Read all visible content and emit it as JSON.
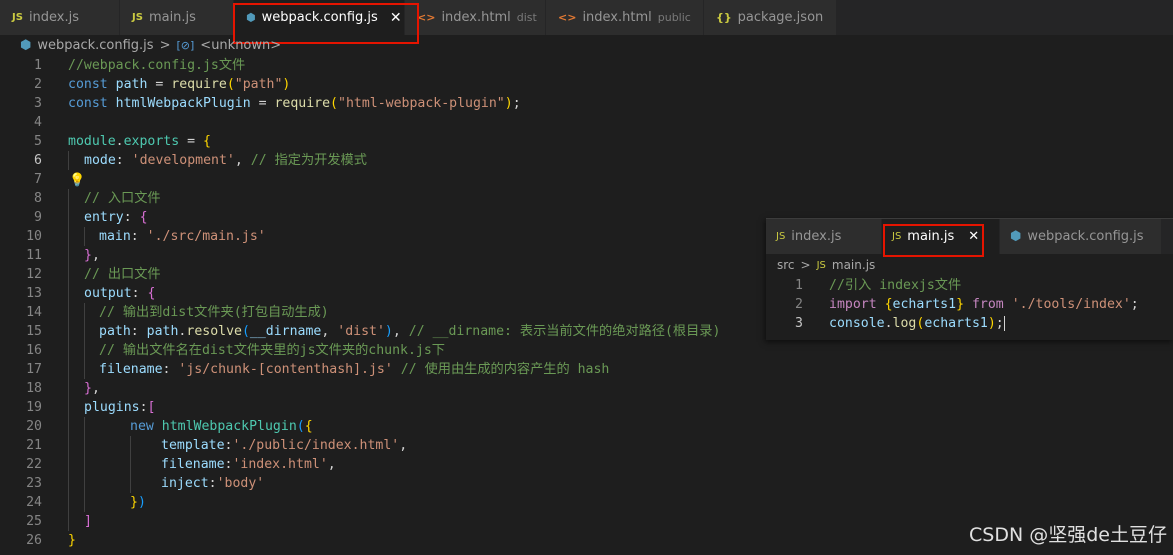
{
  "tabs": [
    {
      "icon": "JS",
      "label": "index.js",
      "sub": "",
      "active": false
    },
    {
      "icon": "JS",
      "label": "main.js",
      "sub": "",
      "active": false
    },
    {
      "icon": "⬢",
      "label": "webpack.config.js",
      "sub": "",
      "active": true
    },
    {
      "icon": "<>",
      "label": "index.html",
      "sub": "dist",
      "active": false
    },
    {
      "icon": "<>",
      "label": "index.html",
      "sub": "public",
      "active": false
    },
    {
      "icon": "{}",
      "label": "package.json",
      "sub": "",
      "active": false
    }
  ],
  "breadcrumb": {
    "file": "webpack.config.js",
    "sep": ">",
    "symbol": "<unknown>"
  },
  "line_numbers": [
    "1",
    "2",
    "3",
    "4",
    "5",
    "6",
    "7",
    "8",
    "9",
    "10",
    "11",
    "12",
    "13",
    "14",
    "15",
    "16",
    "17",
    "18",
    "19",
    "20",
    "21",
    "22",
    "23",
    "24",
    "25",
    "26"
  ],
  "code": {
    "l1": "//webpack.config.js文件",
    "l2_kw": "const",
    "l2_var": "path",
    "l2_op": " = ",
    "l2_fn": "require",
    "l2_str": "\"path\"",
    "l3_kw": "const",
    "l3_var": "htmlWebpackPlugin",
    "l3_op": " = ",
    "l3_fn": "require",
    "l3_str": "\"html-webpack-plugin\"",
    "l5_a": "module",
    "l5_b": "exports",
    "l6_key": "mode",
    "l6_str": "'development'",
    "l6_cm": "// 指定为开发模式",
    "l8_cm": "// 入口文件",
    "l9_key": "entry",
    "l10_key": "main",
    "l10_str": "'./src/main.js'",
    "l12_cm": "// 出口文件",
    "l13_key": "output",
    "l14_cm": "// 输出到dist文件夹(打包自动生成)",
    "l15_key": "path",
    "l15_obj": "path",
    "l15_fn": "resolve",
    "l15_arg": "__dirname",
    "l15_str": "'dist'",
    "l15_cm": "// __dirname: 表示当前文件的绝对路径(根目录)",
    "l16_cm": "// 输出文件名在dist文件夹里的js文件夹的chunk.js下",
    "l17_key": "filename",
    "l17_str": "'js/chunk-[contenthash].js'",
    "l17_cm": "// 使用由生成的内容产生的 hash",
    "l19_key": "plugins",
    "l20_kw": "new",
    "l20_cls": "htmlWebpackPlugin",
    "l21_key": "template",
    "l21_str": "'./public/index.html'",
    "l22_key": "filename",
    "l22_str": "'index.html'",
    "l23_key": "inject",
    "l23_str": "'body'"
  },
  "peek": {
    "tabs": [
      {
        "icon": "JS",
        "label": "index.js",
        "active": false
      },
      {
        "icon": "JS",
        "label": "main.js",
        "active": true
      },
      {
        "icon": "⬢",
        "label": "webpack.config.js",
        "active": false
      }
    ],
    "breadcrumb": {
      "folder": "src",
      "sep": ">",
      "icon": "JS",
      "file": "main.js"
    },
    "line_numbers": [
      "1",
      "2",
      "3"
    ],
    "l1_cm": "//引入 indexjs文件",
    "l2_kw": "import",
    "l2_var": "echarts1",
    "l2_kw2": "from",
    "l2_str": "'./tools/index'",
    "l3_obj": "console",
    "l3_fn": "log",
    "l3_arg": "echarts1"
  },
  "close_glyph": "✕",
  "watermark": "CSDN @坚强de土豆仔",
  "colors": {
    "highlight_box": "#e51400",
    "background": "#1e1e1e"
  }
}
